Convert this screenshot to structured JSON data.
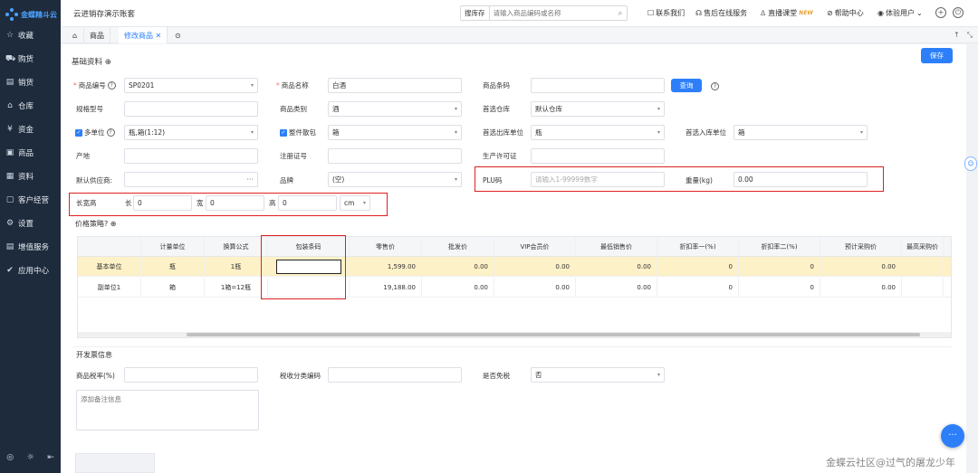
{
  "sidebar": {
    "logo_text": "金蝶精斗云",
    "items": [
      {
        "label": "收藏",
        "icon": "star-icon",
        "glyph": "☆"
      },
      {
        "label": "购货",
        "icon": "cart-icon",
        "glyph": "⛟"
      },
      {
        "label": "销货",
        "icon": "sales-icon",
        "glyph": "▤"
      },
      {
        "label": "仓库",
        "icon": "warehouse-icon",
        "glyph": "⌂"
      },
      {
        "label": "资金",
        "icon": "money-icon",
        "glyph": "¥"
      },
      {
        "label": "商品",
        "icon": "goods-icon",
        "glyph": "▣"
      },
      {
        "label": "资料",
        "icon": "data-icon",
        "glyph": "▦"
      },
      {
        "label": "客户经营",
        "icon": "customer-icon",
        "glyph": "▢"
      },
      {
        "label": "设置",
        "icon": "settings-icon",
        "glyph": "⚙"
      },
      {
        "label": "增值服务",
        "icon": "value-service-icon",
        "glyph": "▤"
      },
      {
        "label": "应用中心",
        "icon": "app-center-icon",
        "glyph": "✔"
      }
    ]
  },
  "topbar": {
    "account_title": "云进销存演示账套",
    "search_tag": "搜库存",
    "search_placeholder": "请输入商品编码或名称",
    "contact": "联系我们",
    "after_sales": "售后在线服务",
    "live": "直播课堂",
    "new_badge": "NEW",
    "help": "帮助中心",
    "user": "体验用户"
  },
  "tabs": [
    {
      "label": "商品"
    },
    {
      "label": "修改商品"
    }
  ],
  "form": {
    "section_basic": "基础资料",
    "save": "保存",
    "code_label": "商品编号",
    "code_value": "SP0201",
    "name_label": "商品名称",
    "name_value": "白酒",
    "barcode_label": "商品条码",
    "query_button": "查询",
    "spec_label": "规格型号",
    "category_label": "商品类别",
    "category_value": "酒",
    "default_wh_label": "首选仓库",
    "default_wh_value": "默认仓库",
    "multi_unit_label": "多单位",
    "multi_unit_value": "瓶,箱(1:12)",
    "whole_pack_label": "整件散包",
    "whole_pack_value": "箱",
    "out_unit_label": "首选出库单位",
    "out_unit_value": "瓶",
    "in_unit_label": "首选入库单位",
    "in_unit_value": "箱",
    "origin_label": "产地",
    "reg_label": "注册证号",
    "license_label": "生产许可证",
    "supplier_label": "默认供应商:",
    "brand_label": "品牌",
    "brand_value": "(空)",
    "plu_label": "PLU码",
    "plu_placeholder": "请输入1-99999数字",
    "weight_label": "重量(kg)",
    "weight_value": "0.00",
    "dims_label": "长宽高",
    "len_label": "长",
    "len_value": "0",
    "wid_label": "宽",
    "wid_value": "0",
    "hgt_label": "高",
    "hgt_value": "0",
    "unit_value": "cm",
    "price_strategy": "价格策略?",
    "section_invoice": "开发票信息",
    "tax_label": "商品税率(%)",
    "tax_code_label": "税收分类编码",
    "tax_free_label": "是否免税",
    "tax_free_value": "否",
    "memo_placeholder": "添加备注信息"
  },
  "price_table": {
    "headers": [
      "",
      "计量单位",
      "换算公式",
      "包装条码",
      "零售价",
      "批发价",
      "VIP会员价",
      "最低销售价",
      "折扣率一(%)",
      "折扣率二(%)",
      "预计采购价",
      "最高采购价"
    ],
    "rows": [
      [
        "基本单位",
        "瓶",
        "1瓶",
        "",
        "1,599.00",
        "0.00",
        "0.00",
        "0.00",
        "0",
        "0",
        "0.00",
        ""
      ],
      [
        "副单位1",
        "箱",
        "1箱=12瓶",
        "",
        "19,188.00",
        "0.00",
        "0.00",
        "0.00",
        "0",
        "0",
        "0.00",
        ""
      ]
    ]
  },
  "watermark": "金蝶云社区@过气的屠龙少年"
}
